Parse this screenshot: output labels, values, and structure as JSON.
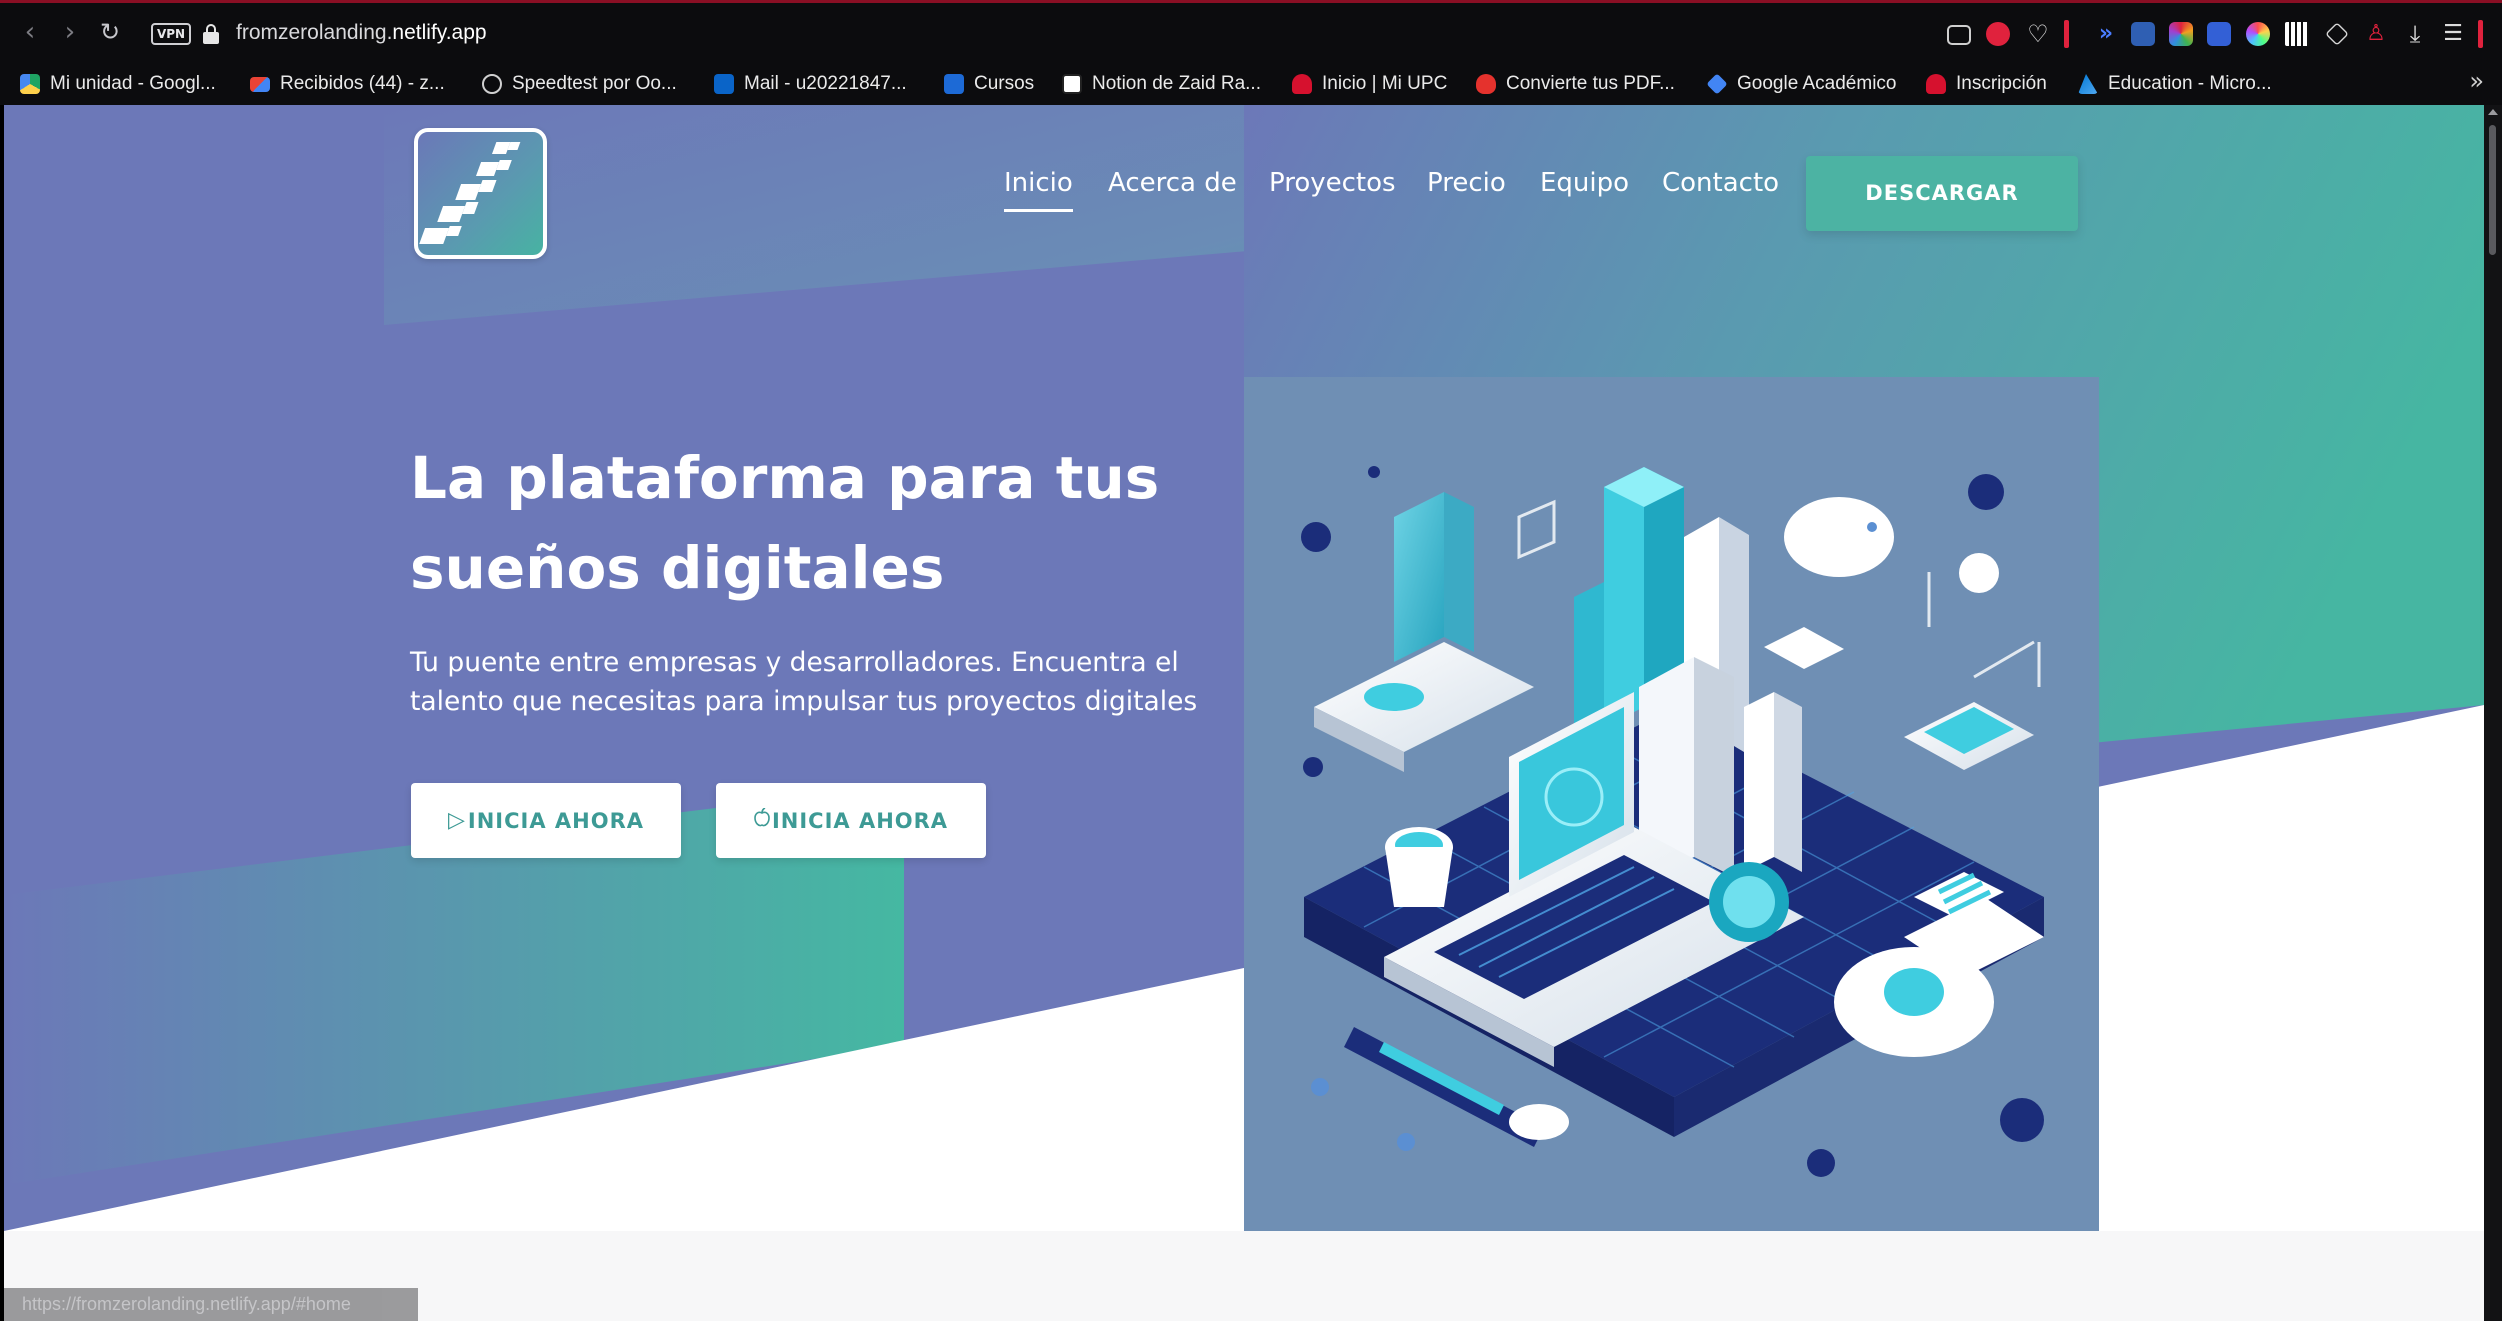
{
  "browser": {
    "url_prefix": "fromzerolanding.",
    "url_host": "netlify.app",
    "vpn_label": "VPN",
    "status_url": "https://fromzerolanding.netlify.app/#home",
    "nav_icons": [
      "back-arrow-icon",
      "forward-arrow-icon",
      "reload-icon",
      "lock-icon"
    ],
    "toolbar_icons": [
      "camera-icon",
      "pocket-icon",
      "heart-icon",
      "extension-icon",
      "dictionary-icon",
      "ublock-icon",
      "color-picker-icon",
      "sidebar-icon",
      "qr-icon",
      "box-icon",
      "profile-icon",
      "download-icon",
      "menu-icon"
    ],
    "bookmarks": [
      {
        "label": "Mi unidad - Googl...",
        "icon": "google-drive-icon"
      },
      {
        "label": "Recibidos (44) - z...",
        "icon": "gmail-icon"
      },
      {
        "label": "Speedtest por Oo...",
        "icon": "speedtest-icon"
      },
      {
        "label": "Mail - u20221847...",
        "icon": "outlook-icon"
      },
      {
        "label": "Cursos",
        "icon": "canvas-icon"
      },
      {
        "label": "Notion de Zaid Ra...",
        "icon": "notion-icon"
      },
      {
        "label": "Inicio | Mi UPC",
        "icon": "upc-icon"
      },
      {
        "label": "Convierte tus PDF...",
        "icon": "pdf-heart-icon"
      },
      {
        "label": "Google Académico",
        "icon": "scholar-icon"
      },
      {
        "label": "Inscripción",
        "icon": "upc-icon"
      },
      {
        "label": "Education - Micro...",
        "icon": "azure-icon"
      }
    ],
    "more_bookmarks": "»"
  },
  "site": {
    "nav": [
      "Inicio",
      "Acerca de",
      "Proyectos",
      "Precio",
      "Equipo",
      "Contacto"
    ],
    "active_nav": "Inicio",
    "download_label": "DESCARGAR",
    "hero_title": "La plataforma para tus sueños digitales",
    "hero_subtitle": "Tu puente entre empresas y desarrolladores. Encuentra el talento que necesitas para impulsar tus proyectos digitales",
    "cta_primary": {
      "icon": "play-icon",
      "glyph": "▷",
      "label": "INICIA AHORA"
    },
    "cta_secondary": {
      "icon": "apple-icon",
      "glyph": "",
      "label": "INICIA AHORA"
    }
  },
  "colors": {
    "hero_purple": "#6c78b8",
    "hero_teal": "#49b8a3",
    "button_teal": "#4cb3a3",
    "button_text": "#3d9a95",
    "chrome_bg": "#0c0c0e",
    "chrome_accent": "#8a0f24"
  }
}
